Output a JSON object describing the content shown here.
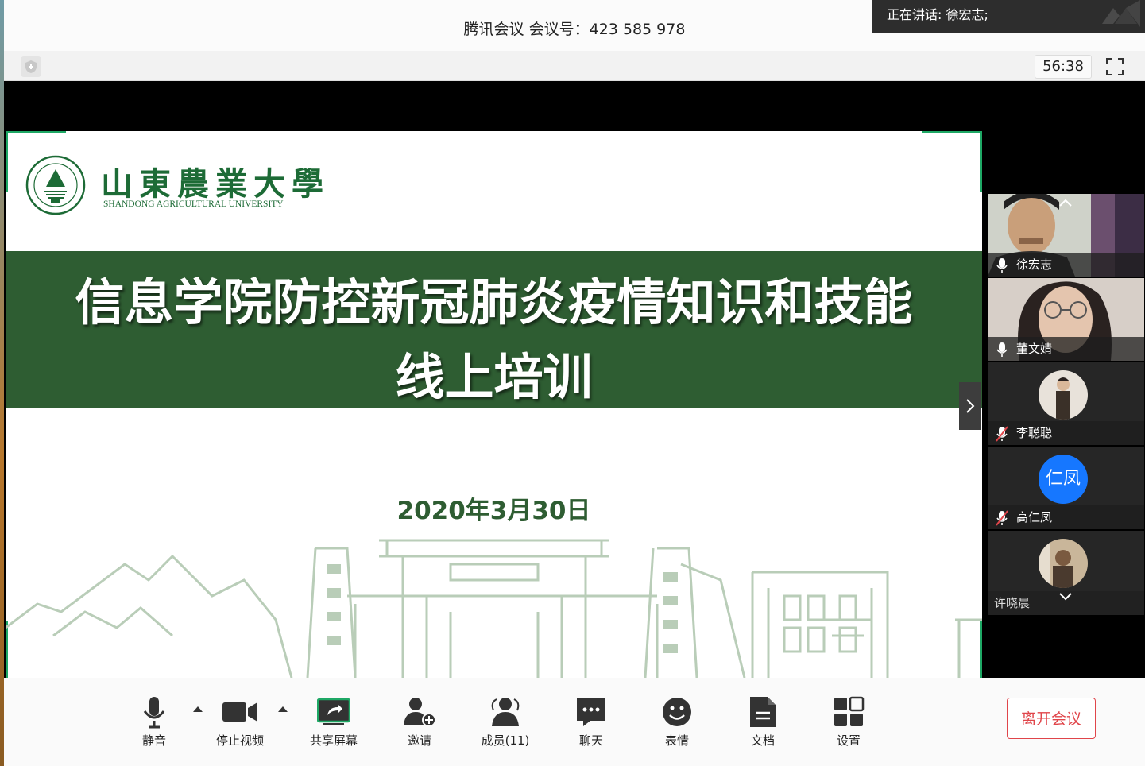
{
  "window": {
    "title": "腾讯会议 会议号：423 585 978",
    "speaking": "正在讲话: 徐宏志;",
    "timer": "56:38"
  },
  "slide": {
    "university_cn": "山東農業大學",
    "university_en": "SHANDONG AGRICULTURAL UNIVERSITY",
    "title_line1": "信息学院防控新冠肺炎疫情知识和技能",
    "title_line2": "线上培训",
    "date": "2020年3月30日",
    "brand_color": "#2e5d32"
  },
  "participants": [
    {
      "name": "徐宏志",
      "mic": "on",
      "video": "on"
    },
    {
      "name": "董文婧",
      "mic": "on",
      "video": "on"
    },
    {
      "name": "李聪聪",
      "mic": "muted",
      "video": "avatar"
    },
    {
      "name": "高仁凤",
      "mic": "muted",
      "video": "avatar",
      "avatar_text": "仁凤",
      "avatar_color": "#1677ff"
    },
    {
      "name": "许晓晨",
      "mic": "none",
      "video": "avatar"
    }
  ],
  "toolbar": {
    "mute": "静音",
    "stop_video": "停止视频",
    "share_screen": "共享屏幕",
    "invite": "邀请",
    "members": "成员(11)",
    "chat": "聊天",
    "emoji": "表情",
    "docs": "文档",
    "settings": "设置",
    "leave": "离开会议"
  },
  "icons": [
    "shield-icon",
    "fullscreen-icon",
    "microphone-icon",
    "video-camera-icon",
    "share-screen-icon",
    "invite-icon",
    "members-icon",
    "chat-icon",
    "emoji-icon",
    "document-icon",
    "settings-icon",
    "chevron-up-icon",
    "chevron-down-icon",
    "chevron-right-icon",
    "mic-muted-icon"
  ]
}
